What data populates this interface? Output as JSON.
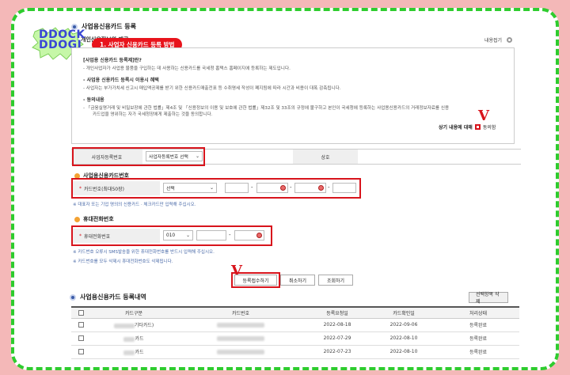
{
  "page": {
    "title": "사업용신용카드 등록",
    "section_title_partial": "개인신용정보의 제공",
    "logo_line1": "DDOCK",
    "logo_line2": "DDOGI",
    "callout": "1. 사업자 신용카드 등록 방법",
    "collapse_label": "내용접기"
  },
  "terms": {
    "h1": "[사업용 신용카드 등록제]란?",
    "p1": "- 개인사업자가 사업용 물품을 구입하는 데 사용하는 신용카드를 국세청 홈택스 홈페이지에 등록하는 제도입니다.",
    "h2": "- 사업용 신용카드 등록시 이용시 혜택",
    "p2": "- 사업자는 부가가치세 신고시 매입액공제를 받기 위한 신용카드매출전표 등 수취명세 작성이 폐지됨에 따라 시간과 비용이 대폭 감축됩니다.",
    "h3": "- 동의내용",
    "p3": "- 「금융실명거래 및 비밀보장에 관한 법률」제4조 및 「신용정보의 이용 및 보호에 관한 법률」제32조 및 33조의 규정에 불구하고 본인이 국세청에 등록하는 사업용신용카드의    거래정보자료를 신용",
    "p3b": "카드업을 영위하는 자가 국세청장에게 제출하는 것을 동의합니다.",
    "agree_text": "상기 내용에 대해",
    "agree_label": "동의함"
  },
  "biz": {
    "label": "사업자등록번호",
    "select": "사업자등록번호 선택",
    "name_label": "상호"
  },
  "card": {
    "section": "사업용신용카드번호",
    "label": "카드번호(최대50장)",
    "select": "선택",
    "dash": "-",
    "note": "※ 대표자 또는 기업 명의의 신용카드 · 체크카드만 입력해 주십시오."
  },
  "phone": {
    "section": "휴대전화번호",
    "label": "휴대전화번호",
    "select": "010",
    "dash": "-",
    "note1": "※ 카드번호 오류시 SMS발송을 위한 휴대전화번호를 반드시 입력해 주십시오.",
    "note2": "※ 카드번호를 모두 삭제시 휴대전화번호도 삭제됩니다."
  },
  "buttons": {
    "register": "등록접수하기",
    "cancel": "취소하기",
    "lookup": "조회하기",
    "delete": "선택항목 삭제"
  },
  "list": {
    "title": "사업용신용카드 등록내역",
    "headers": [
      "카드구분",
      "카드번호",
      "등록요청일",
      "카드확인일",
      "처리상태"
    ],
    "rows": [
      {
        "kind": "기타카드)",
        "req": "2022-08-18",
        "confirm": "2022-09-06",
        "status": "등록완료"
      },
      {
        "kind": "카드",
        "req": "2022-07-29",
        "confirm": "2022-08-10",
        "status": "등록완료"
      },
      {
        "kind": "카드",
        "req": "2022-07-23",
        "confirm": "2022-08-10",
        "status": "등록완료"
      }
    ]
  },
  "marks": {
    "check": "V"
  },
  "icons": {
    "settings": "gear-icon",
    "dropdown": "chevron-down-icon",
    "eye": "eye-icon"
  },
  "colors": {
    "accent_red": "#d8141c",
    "border_green": "#2ecc2e",
    "bg_pink": "#f4b8b8",
    "logo_blue": "#3a46d6"
  }
}
